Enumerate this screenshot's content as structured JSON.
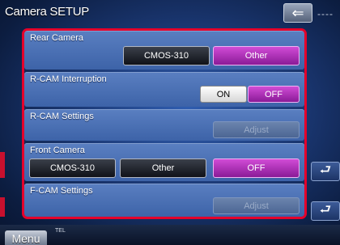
{
  "header": {
    "title": "Camera SETUP",
    "back_icon": "back-arrow-icon",
    "status": "----"
  },
  "rows": {
    "rear_camera": {
      "label": "Rear Camera",
      "options": [
        "CMOS-310",
        "Other"
      ],
      "selected": "Other"
    },
    "rcam_interruption": {
      "label": "R-CAM Interruption",
      "options": [
        "ON",
        "OFF"
      ],
      "selected": "OFF"
    },
    "rcam_settings": {
      "label": "R-CAM Settings",
      "button": "Adjust"
    },
    "front_camera": {
      "label": "Front Camera",
      "options": [
        "CMOS-310",
        "Other",
        "OFF"
      ],
      "selected": "OFF"
    },
    "fcam_settings": {
      "label": "F-CAM Settings",
      "button": "Adjust"
    }
  },
  "side": {
    "return_icon": "return-arrow-icon"
  },
  "footer": {
    "menu_label": "Menu",
    "tel_label": "TEL"
  },
  "colors": {
    "accent_selected": "#b030bd",
    "highlight_border": "#e4002b",
    "row_bg": "#4a6fb4"
  }
}
